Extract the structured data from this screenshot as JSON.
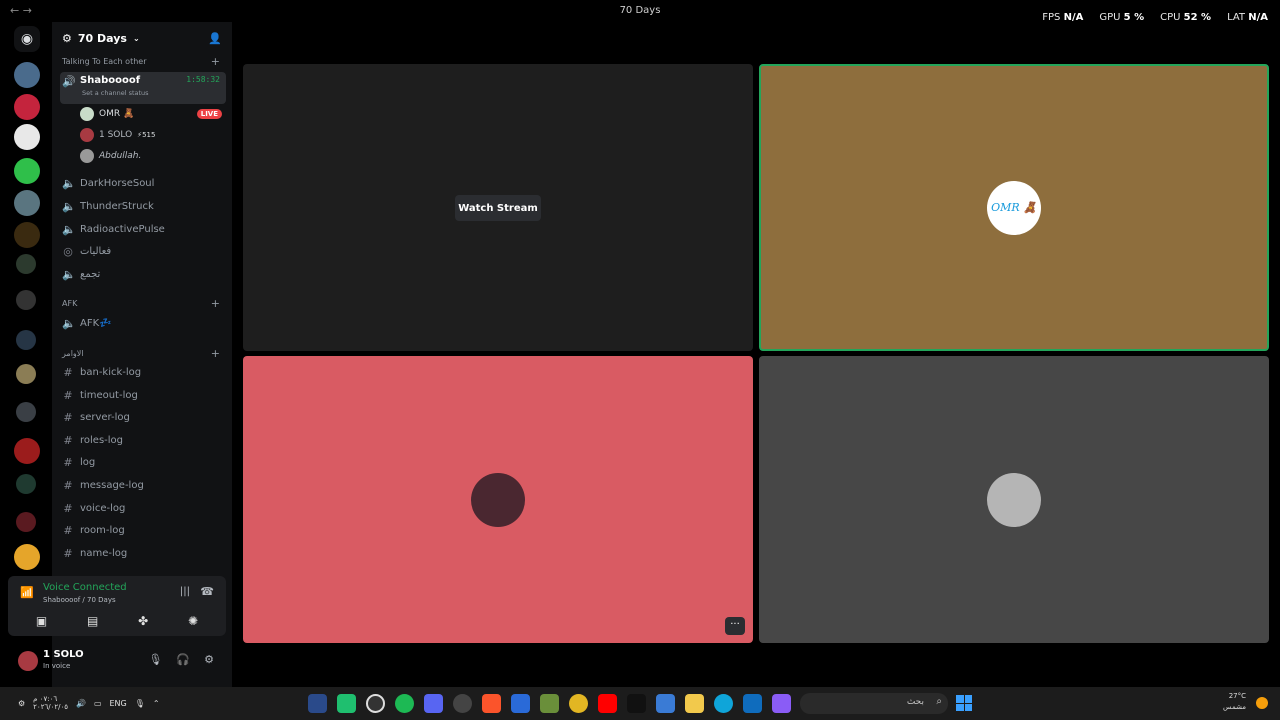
{
  "window": {
    "title": "70 Days",
    "back": "←  →"
  },
  "overlay": {
    "fps_label": "FPS",
    "fps_value": "N/A",
    "gpu_label": "GPU",
    "gpu_value": "5 %",
    "cpu_label": "CPU",
    "cpu_value": "52 %",
    "lat_label": "LAT",
    "lat_value": "N/A"
  },
  "server": {
    "name": "70 Days"
  },
  "categories": {
    "talking": "Talking To Each other",
    "afk": "AFK",
    "commands": "الاوامر"
  },
  "active_channel": {
    "name": "Shaboooof",
    "timer": "1:58:32",
    "status_placeholder": "Set a channel status"
  },
  "voice_users": [
    {
      "name": "OMR 🧸",
      "badge": "LIVE"
    },
    {
      "name": "1 SOLO",
      "extra": "⚡515"
    },
    {
      "name": "Abdullah."
    }
  ],
  "voice_channels": [
    "DarkHorseSoul",
    "ThunderStruck",
    "RadioactivePulse",
    "فعاليات",
    "تجمع"
  ],
  "afk_channel": "AFK💤",
  "text_channels": [
    "ban-kick-log",
    "timeout-log",
    "server-log",
    "roles-log",
    "log",
    "message-log",
    "voice-log",
    "room-log",
    "name-log"
  ],
  "voice_panel": {
    "status": "Voice Connected",
    "location": "Shaboooof / 70 Days"
  },
  "user_panel": {
    "name": "1 SOLO",
    "status": "In voice"
  },
  "stage": {
    "watch_label": "Watch Stream",
    "omr_avatar_text": "OMR 🧸",
    "more_label": "···"
  },
  "taskbar": {
    "time": "٠٧:٠٦ م",
    "date": "٢٠٢٦/٠٢/٠٥",
    "lang": "ENG",
    "search": "بحث",
    "temp": "27°C",
    "weather": "مشمس"
  },
  "colors": {
    "omr_tile": "#8e6e3d",
    "solo_tile": "#d95b63",
    "abdullah_tile": "#474747",
    "stream_tile": "#1e1e1e",
    "accent_green": "#23a55a"
  }
}
